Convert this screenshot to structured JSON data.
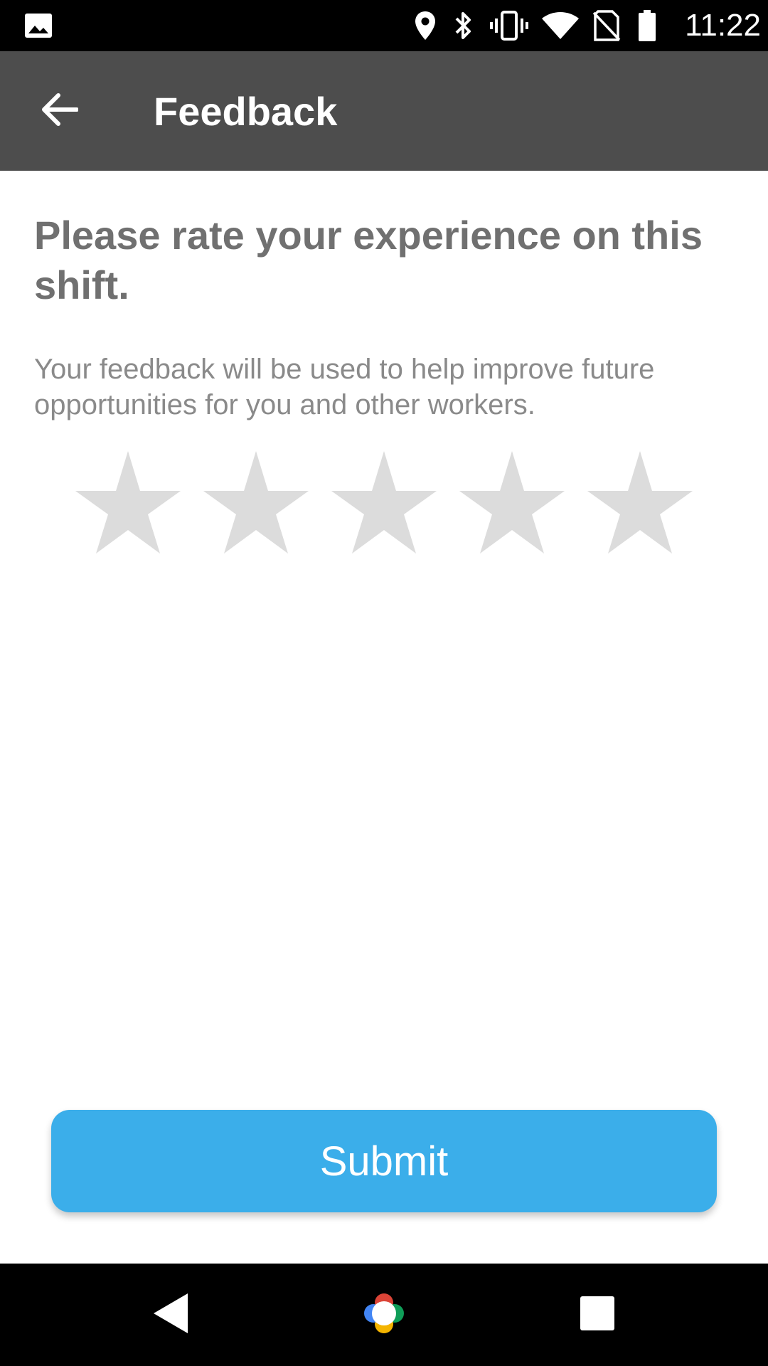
{
  "status_bar": {
    "time": "11:22",
    "icons": [
      "gallery-icon",
      "location-icon",
      "bluetooth-icon",
      "vibrate-icon",
      "wifi-icon",
      "no-sim-icon",
      "battery-icon"
    ]
  },
  "app_bar": {
    "title": "Feedback",
    "back_icon": "arrow-back-icon",
    "background_color": "#4d4d4d"
  },
  "content": {
    "heading": "Please rate your experience on this shift.",
    "description": "Your feedback will be used to help improve future opportunities for you and other workers.",
    "rating": {
      "max": 5,
      "value": 0,
      "empty_color": "#dcdcdc"
    }
  },
  "submit": {
    "label": "Submit",
    "color": "#3baeea"
  },
  "nav_bar": {
    "icons": [
      "nav-back-icon",
      "nav-home-icon",
      "nav-recents-icon"
    ]
  }
}
